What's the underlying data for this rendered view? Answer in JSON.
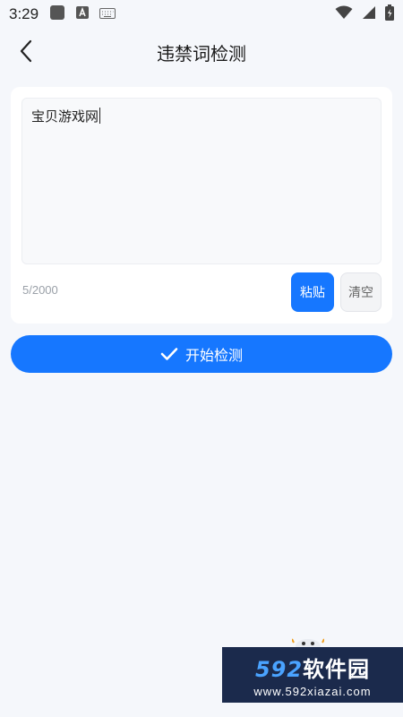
{
  "status_bar": {
    "time": "3:29"
  },
  "header": {
    "title": "违禁词检测"
  },
  "editor": {
    "text": "宝贝游戏网",
    "char_count": "5/2000",
    "paste_label": "粘贴",
    "clear_label": "清空"
  },
  "action": {
    "detect_label": "开始检测"
  },
  "watermark": {
    "brand_num": "592",
    "brand_text": "软件园",
    "url": "www.592xiazai.com"
  },
  "colors": {
    "accent": "#1677ff",
    "background": "#f5f7fb"
  }
}
